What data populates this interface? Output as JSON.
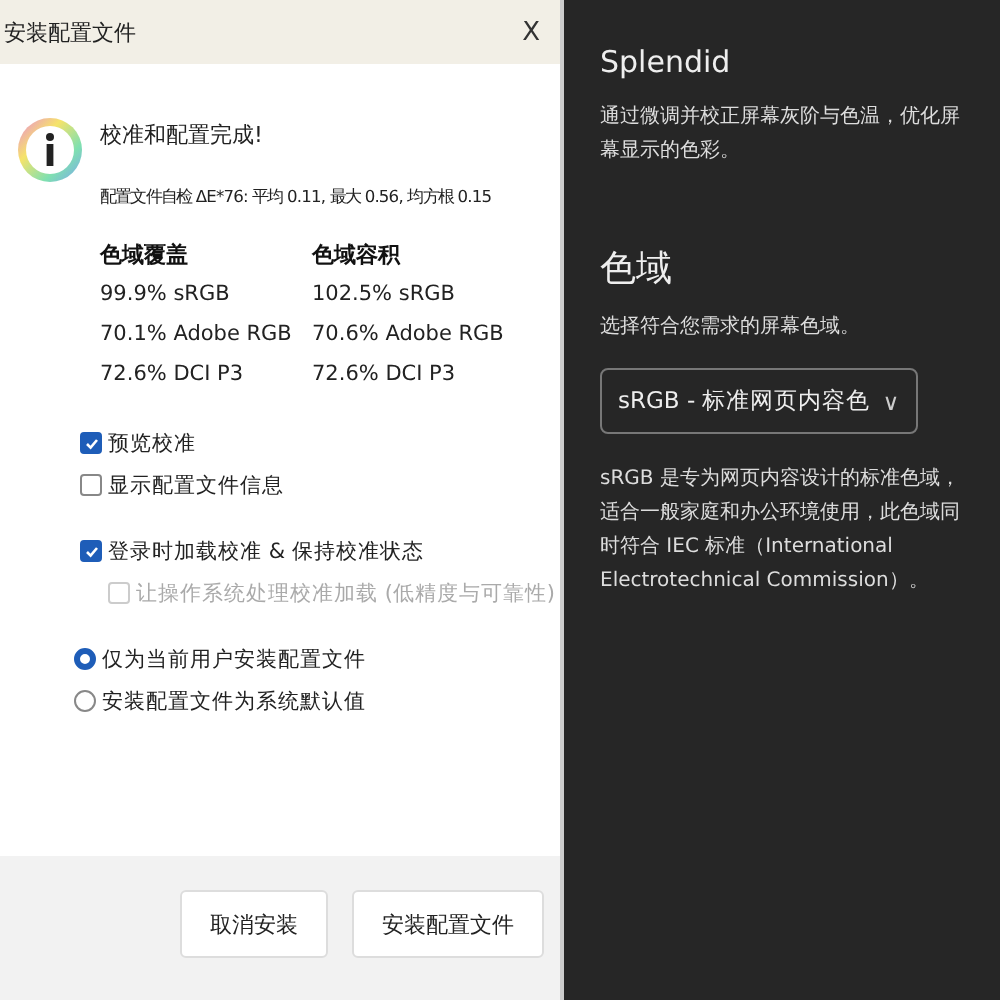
{
  "dialog": {
    "title": "安装配置文件",
    "close": "X",
    "message": "校准和配置完成!",
    "self_check": "配置文件自检 ΔE*76: 平均 0.11, 最大 0.56, 均方根 0.15",
    "gamut_columns": [
      {
        "heading": "色域覆盖",
        "values": [
          "99.9% sRGB",
          "70.1% Adobe RGB",
          "72.6% DCI P3"
        ]
      },
      {
        "heading": "色域容积",
        "values": [
          "102.5% sRGB",
          "70.6% Adobe RGB",
          "72.6% DCI P3"
        ]
      }
    ],
    "option_groups": [
      {
        "options": [
          {
            "label": "预览校准",
            "checked": true,
            "disabled": false
          },
          {
            "label": "显示配置文件信息",
            "checked": false,
            "disabled": false
          }
        ]
      },
      {
        "options": [
          {
            "label": "登录时加载校准 & 保持校准状态",
            "checked": true,
            "disabled": false,
            "children": [
              {
                "label": "让操作系统处理校准加载 (低精度与可靠性)",
                "checked": false,
                "disabled": true
              }
            ]
          }
        ]
      }
    ],
    "install_scope": [
      {
        "label": "仅为当前用户安装配置文件",
        "selected": true
      },
      {
        "label": "安装配置文件为系统默认值",
        "selected": false
      }
    ],
    "buttons": [
      "取消安装",
      "安装配置文件"
    ]
  },
  "panel": {
    "title": "Splendid",
    "description": "通过微调并校正屏幕灰阶与色温，优化屏幕显示的色彩。",
    "section_title": "色域",
    "section_hint": "选择符合您需求的屏幕色域。",
    "dropdown_value": "sRGB - 标准网页内容色",
    "dropdown_caret": "∨",
    "note": "sRGB 是专为网页内容设计的标准色域，适合一般家庭和办公环境使用，此色域同时符合 IEC 标准（International Electrotechnical Commission）。"
  }
}
